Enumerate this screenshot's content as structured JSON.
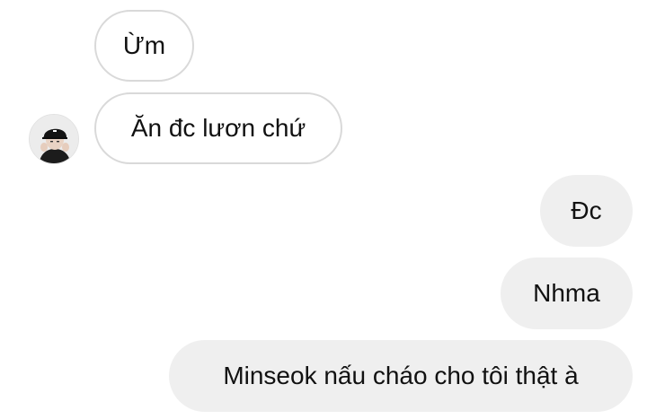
{
  "chat": {
    "messages": [
      {
        "text": "Ừm",
        "direction": "incoming"
      },
      {
        "text": "Ăn đc lươn chứ",
        "direction": "incoming"
      },
      {
        "text": "Đc",
        "direction": "outgoing"
      },
      {
        "text": "Nhma",
        "direction": "outgoing"
      },
      {
        "text": "Minseok nấu cháo cho tôi thật à",
        "direction": "outgoing"
      }
    ],
    "avatar_icon": "contact-avatar-photo"
  },
  "colors": {
    "background": "#ffffff",
    "incoming_bubble_border": "#d9d9d9",
    "outgoing_bubble_fill": "#efefef",
    "text": "#111111"
  }
}
